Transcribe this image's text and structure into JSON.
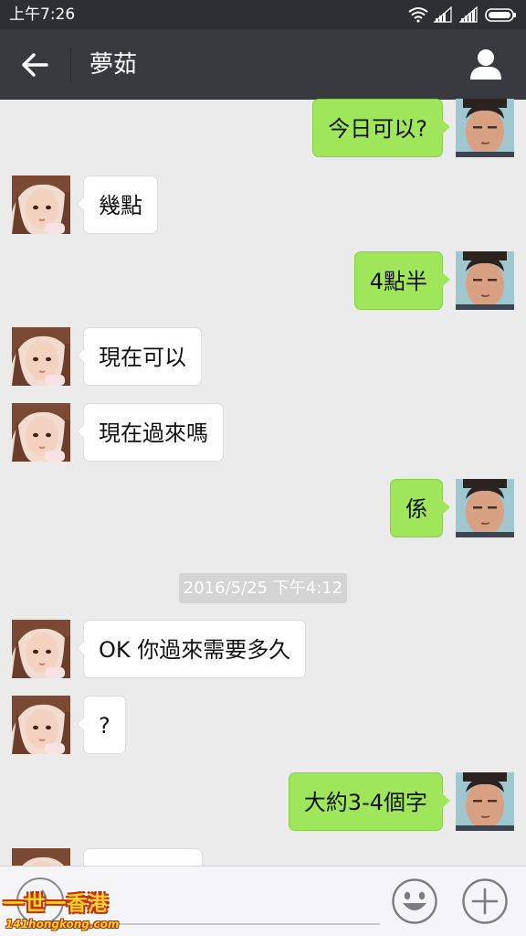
{
  "status_bar": {
    "time": "上午7:26"
  },
  "header": {
    "title": "夢茹"
  },
  "timestamp": "2016/5/25 下午4:12",
  "messages": [
    {
      "side": "right",
      "text": "今日可以?"
    },
    {
      "side": "left",
      "text": "幾點"
    },
    {
      "side": "right",
      "text": "4點半"
    },
    {
      "side": "left",
      "text": "現在可以"
    },
    {
      "side": "left",
      "text": "現在過來嗎"
    },
    {
      "side": "right",
      "text": "係"
    },
    {
      "side": "left",
      "text": "OK 你過來需要多久"
    },
    {
      "side": "left",
      "text": "?"
    },
    {
      "side": "right",
      "text": "大約3-4個字"
    },
    {
      "side": "left",
      "text": ""
    }
  ],
  "input_bar": {
    "input_value": ""
  },
  "watermark": {
    "line1": "一世一香港",
    "line2": "141hongkong.com"
  },
  "icons": {
    "back": "arrow-left-icon",
    "profile": "person-icon",
    "voice": "voice-icon",
    "emoji": "smiley-icon",
    "plus": "plus-icon",
    "wifi": "wifi-icon",
    "signal": "signal-icon",
    "battery": "battery-icon"
  },
  "colors": {
    "header_bg": "#393a3f",
    "status_bg": "#2e2f33",
    "chat_bg": "#ebebeb",
    "sent_bubble": "#9fe65b",
    "received_bubble": "#ffffff"
  }
}
